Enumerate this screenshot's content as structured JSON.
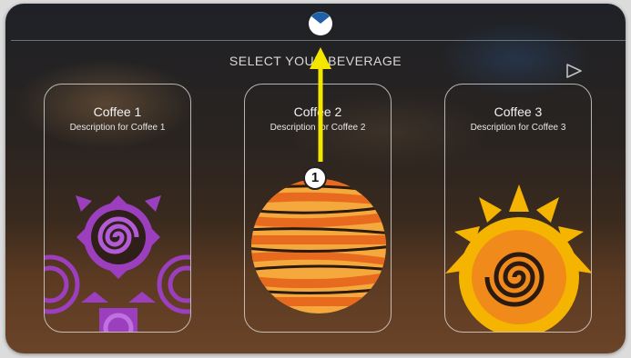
{
  "header": {
    "title": "SELECT YOUR BEVERAGE"
  },
  "navigation": {
    "next_icon": "play-triangle-outline"
  },
  "beverages": [
    {
      "name": "Coffee 1",
      "description": "Description for Coffee 1",
      "art": "purple-spiral-star"
    },
    {
      "name": "Coffee 2",
      "description": "Description for Coffee 2",
      "art": "orange-striped-globe"
    },
    {
      "name": "Coffee 3",
      "description": "Description for Coffee 3",
      "art": "yellow-sun-spiral"
    }
  ],
  "annotation": {
    "label": "1",
    "color": "#f5e600"
  },
  "colors": {
    "accent_blue": "#1d5fa8",
    "coffee1": "#a04fc0",
    "coffee2": "#f0842a",
    "coffee3": "#f4b400"
  }
}
